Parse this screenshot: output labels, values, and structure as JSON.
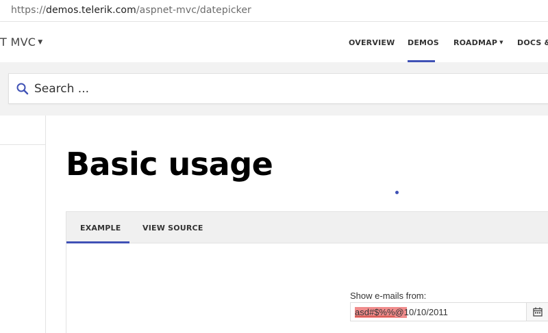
{
  "browser": {
    "url_prefix": "https://",
    "url_host": "demos.telerik.com",
    "url_path": "/aspnet-mvc/datepicker"
  },
  "nav": {
    "brand": "T MVC",
    "items": [
      "OVERVIEW",
      "DEMOS",
      "ROADMAP",
      "DOCS &"
    ],
    "active": "DEMOS",
    "accent_color": "#3f51b5"
  },
  "search": {
    "placeholder": "Search ..."
  },
  "main": {
    "heading": "Basic usage",
    "tabs": [
      "EXAMPLE",
      "VIEW SOURCE"
    ],
    "active_tab": "EXAMPLE"
  },
  "datepicker": {
    "label": "Show e-mails from:",
    "value_invalid_part": "asd#$%%",
    "value_date_part": "@10/10/2011",
    "button_icon": "calendar-icon",
    "highlight_color": "#f08c8c"
  }
}
